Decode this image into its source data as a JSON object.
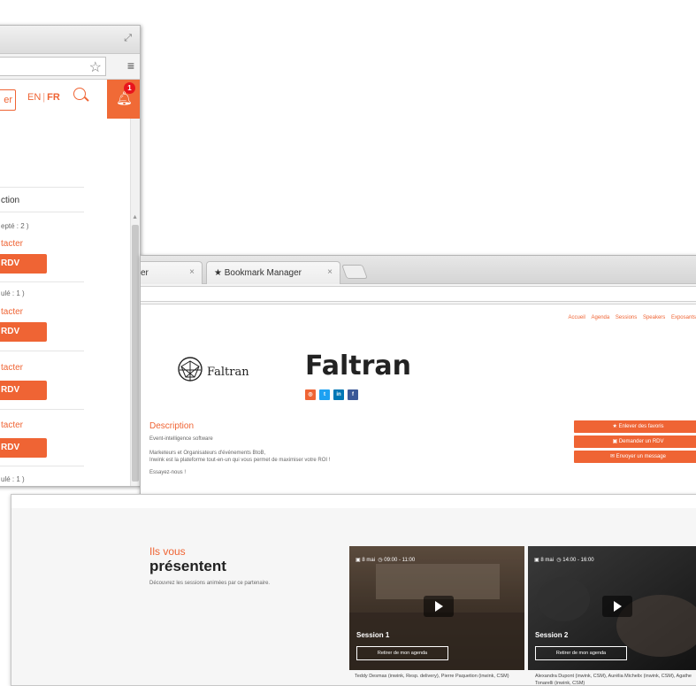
{
  "window1": {
    "register_label": "er",
    "lang_en": "EN",
    "lang_fr": "FR",
    "notification_count": "1",
    "section_label": "ction",
    "entries": [
      {
        "status": "epté : 2 )",
        "contact_label": "tacter",
        "rdv_label": "RDV"
      },
      {
        "status": "ulé : 1 )",
        "contact_label": "tacter",
        "rdv_label": "RDV"
      },
      {
        "status": "",
        "contact_label": "tacter",
        "rdv_label": "RDV"
      },
      {
        "status": "",
        "contact_label": "tacter",
        "rdv_label": "RDV"
      },
      {
        "status": "ulé : 1 )",
        "contact_label": "tacter",
        "rdv_label": ""
      }
    ]
  },
  "window2": {
    "tabs": [
      {
        "label": "ser"
      },
      {
        "label": "Bookmark Manager"
      }
    ],
    "nav": [
      "Accueil",
      "Agenda",
      "Sessions",
      "Speakers",
      "Exposants"
    ],
    "logo_text": "Faltran",
    "company_name": "Faltran",
    "description_title": "Description",
    "description_lines": [
      "Event-intelligence software",
      "Marketeurs et Organisateurs d'événements BtoB,",
      "Inwink est la plateforme tout-en-un qui vous permet de maximiser votre ROI !",
      "Essayez-nous !"
    ],
    "actions": {
      "favorites": "Enlever des favoris",
      "rdv": "Demander un RDV",
      "message": "Envoyer un message"
    },
    "colors": {
      "accent": "#ef6434"
    }
  },
  "window3": {
    "ils_vous": "Ils vous",
    "presentent": "présentent",
    "subtitle": "Découvrez les sessions animées par ce partenaire.",
    "sessions": [
      {
        "date": "8 mai",
        "time": "09:00 - 11:00",
        "title": "Session 1",
        "agenda_label": "Retirer de mon agenda",
        "speakers": "Teddy Desmas (inwink, Resp. delivery), Pierre Paquetion (inwink, CSM)"
      },
      {
        "date": "8 mai",
        "time": "14:00 - 16:00",
        "title": "Session 2",
        "agenda_label": "Retirer de mon agenda",
        "speakers": "Alexandra Dupont (inwink, CSM), Aurélia Michelix (inwink, CSM), Agathe Tonarelli (inwink, CSM)"
      }
    ]
  }
}
